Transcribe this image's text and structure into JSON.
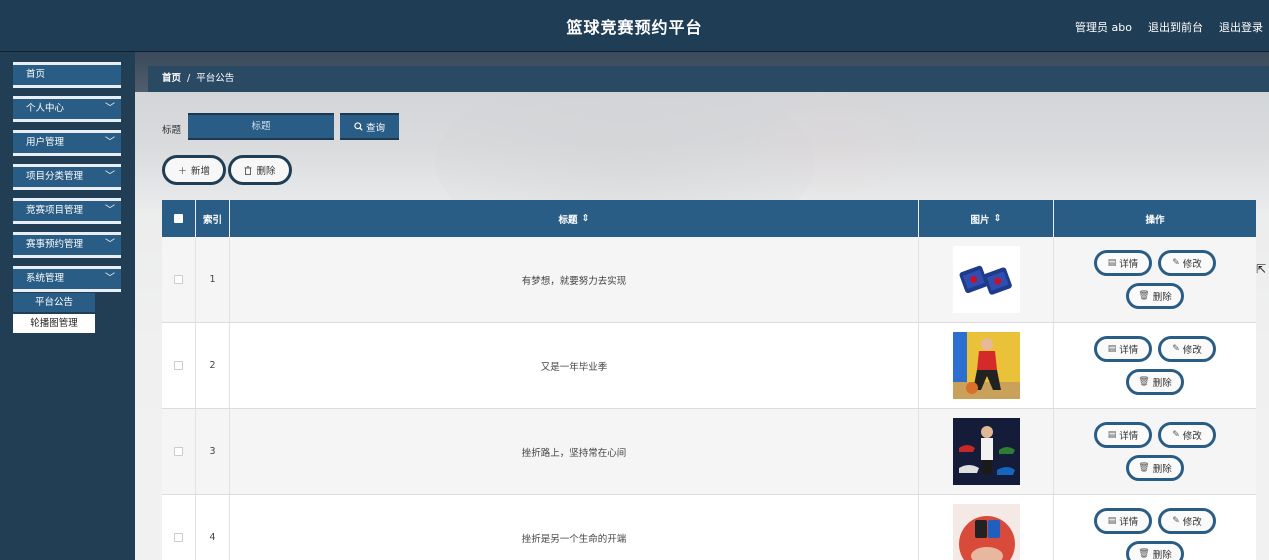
{
  "header": {
    "title": "篮球竞赛预约平台",
    "admin": "管理员 abo",
    "to_front": "退出到前台",
    "logout": "退出登录"
  },
  "sidebar": {
    "items": [
      {
        "label": "首页",
        "chevron": false
      },
      {
        "label": "个人中心",
        "chevron": true
      },
      {
        "label": "用户管理",
        "chevron": true
      },
      {
        "label": "项目分类管理",
        "chevron": true
      },
      {
        "label": "竞赛项目管理",
        "chevron": true
      },
      {
        "label": "赛事预约管理",
        "chevron": true
      },
      {
        "label": "系统管理",
        "chevron": true
      }
    ],
    "submenu": [
      {
        "label": "平台公告",
        "active": true
      },
      {
        "label": "轮播图管理",
        "active": false
      }
    ]
  },
  "breadcrumb": {
    "home": "首页",
    "sep": "/",
    "current": "平台公告"
  },
  "search": {
    "label": "标题",
    "placeholder": "标题",
    "button": "查询"
  },
  "actions": {
    "add": "新增",
    "delete": "删除"
  },
  "table": {
    "headers": {
      "index": "索引",
      "title": "标题",
      "image": "图片",
      "ops": "操作"
    },
    "rows": [
      {
        "index": "1",
        "title": "有梦想，就要努力去实现"
      },
      {
        "index": "2",
        "title": "又是一年毕业季"
      },
      {
        "index": "3",
        "title": "挫折路上，坚持常在心间"
      },
      {
        "index": "4",
        "title": "挫折是另一个生命的开端"
      }
    ],
    "op_labels": {
      "detail": "详情",
      "edit": "修改",
      "delete": "删除"
    }
  },
  "icons": {
    "search": "search-icon",
    "add": "plus-icon",
    "delete": "trash-icon",
    "detail": "document-icon",
    "edit": "pencil-icon",
    "sort": "sort-icon",
    "chevron": "chevron-down-icon"
  },
  "colors": {
    "header_bg": "#1f3d54",
    "accent": "#2a5d86",
    "sidebar_bg": "#213e54"
  }
}
